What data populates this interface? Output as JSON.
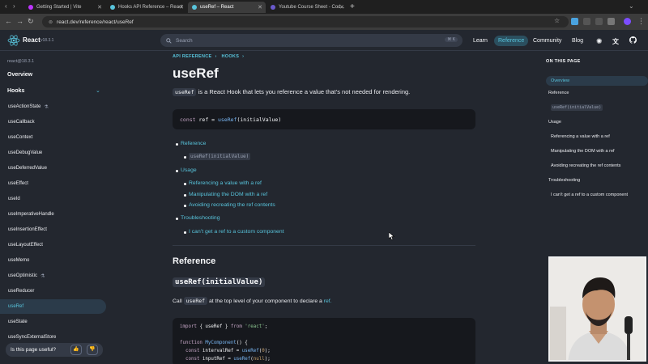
{
  "browser": {
    "tabs": [
      {
        "title": "Getting Started | Vite",
        "active": false,
        "favicon_color": "#bd34fe"
      },
      {
        "title": "Hooks API Reference – React",
        "active": false,
        "favicon_color": "#58c4dc"
      },
      {
        "title": "useRef – React",
        "active": true,
        "favicon_color": "#58c4dc"
      },
      {
        "title": "Youtube Course Sheet - Cod...",
        "active": false,
        "favicon_color": "#6a5acd"
      }
    ],
    "url": "react.dev/reference/react/useRef"
  },
  "header": {
    "brand": "React",
    "version": "v18.3.1",
    "search_placeholder": "Search",
    "search_shortcut": "⌘ K",
    "nav": [
      {
        "label": "Learn",
        "active": false
      },
      {
        "label": "Reference",
        "active": true
      },
      {
        "label": "Community",
        "active": false
      },
      {
        "label": "Blog",
        "active": false
      }
    ]
  },
  "sidebar": {
    "version_label": "react@18.3.1",
    "overview": "Overview",
    "section": "Hooks",
    "items": [
      {
        "label": "useActionState",
        "flask": true,
        "active": false
      },
      {
        "label": "useCallback",
        "flask": false,
        "active": false
      },
      {
        "label": "useContext",
        "flask": false,
        "active": false
      },
      {
        "label": "useDebugValue",
        "flask": false,
        "active": false
      },
      {
        "label": "useDeferredValue",
        "flask": false,
        "active": false
      },
      {
        "label": "useEffect",
        "flask": false,
        "active": false
      },
      {
        "label": "useId",
        "flask": false,
        "active": false
      },
      {
        "label": "useImperativeHandle",
        "flask": false,
        "active": false
      },
      {
        "label": "useInsertionEffect",
        "flask": false,
        "active": false
      },
      {
        "label": "useLayoutEffect",
        "flask": false,
        "active": false
      },
      {
        "label": "useMemo",
        "flask": false,
        "active": false
      },
      {
        "label": "useOptimistic",
        "flask": true,
        "active": false
      },
      {
        "label": "useReducer",
        "flask": false,
        "active": false
      },
      {
        "label": "useRef",
        "flask": false,
        "active": true
      },
      {
        "label": "useState",
        "flask": false,
        "active": false
      },
      {
        "label": "useSyncExternalStore",
        "flask": false,
        "active": false
      }
    ],
    "feedback_question": "Is this page useful?"
  },
  "main": {
    "breadcrumbs": [
      "API REFERENCE",
      "HOOKS"
    ],
    "title": "useRef",
    "intro_code": "useRef",
    "intro_text": "is a React Hook that lets you reference a value that’s not needed for rendering.",
    "signature": {
      "kw": "const",
      "var": " ref = ",
      "fn": "useRef",
      "args": "(initialValue)"
    },
    "toc": {
      "reference": "Reference",
      "reference_sub": "useRef(initialValue)",
      "usage": "Usage",
      "usage_subs": [
        "Referencing a value with a ref",
        "Manipulating the DOM with a ref",
        "Avoiding recreating the ref contents"
      ],
      "troubleshooting": "Troubleshooting",
      "troubleshooting_sub": "I can’t get a ref to a custom component"
    },
    "reference_heading": "Reference",
    "subheading": "useRef(initialValue)",
    "call_pre": "Call",
    "call_code": "useRef",
    "call_mid": "at the top level of your component to declare a",
    "call_link": "ref.",
    "code_lines": {
      "l1_kw": "import",
      "l1_mid": " { useRef } ",
      "l1_kw2": "from",
      "l1_str": " 'react'",
      "l1_end": ";",
      "l2_kw": "function",
      "l2_fn": " MyComponent",
      "l2_end": "() {",
      "l3_kw": "  const",
      "l3_mid": " intervalRef = ",
      "l3_fn": "useRef",
      "l3_open": "(",
      "l3_num": "0",
      "l3_close": ");",
      "l4_kw": "  const",
      "l4_mid": " inputRef = ",
      "l4_fn": "useRef",
      "l4_open": "(",
      "l4_num": "null",
      "l4_close": ");"
    }
  },
  "on_this_page": {
    "title": "ON THIS PAGE",
    "items": [
      {
        "label": "Overview",
        "level": 0,
        "active": true
      },
      {
        "label": "Reference",
        "level": 0,
        "active": false
      },
      {
        "label": "useRef(initialValue)",
        "level": 1,
        "code": true,
        "active": false
      },
      {
        "label": "Usage",
        "level": 0,
        "active": false
      },
      {
        "label": "Referencing a value with a ref",
        "level": 1,
        "active": false
      },
      {
        "label": "Manipulating the DOM with a ref",
        "level": 1,
        "active": false
      },
      {
        "label": "Avoiding recreating the ref contents",
        "level": 1,
        "active": false
      },
      {
        "label": "Troubleshooting",
        "level": 0,
        "active": false
      },
      {
        "label": "I can’t get a ref to a custom component",
        "level": 1,
        "active": false
      }
    ]
  },
  "colors": {
    "accent": "#58c4dc",
    "background": "#23272f",
    "code_bg": "#16181d"
  }
}
